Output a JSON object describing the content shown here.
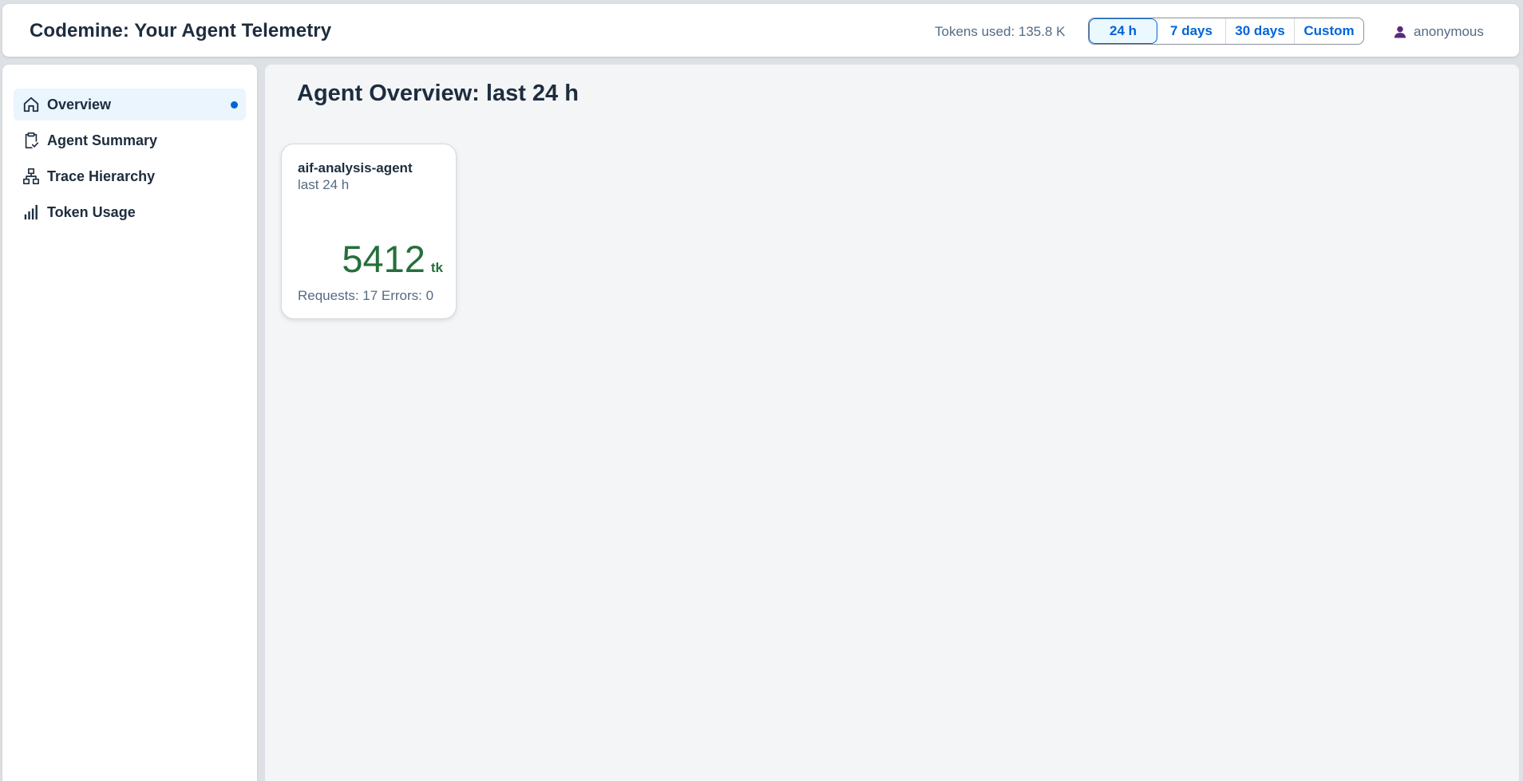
{
  "header": {
    "app_title": "Codemine: Your Agent Telemetry",
    "tokens_used": "Tokens used: 135.8 K",
    "time_ranges": [
      "24 h",
      "7 days",
      "30 days",
      "Custom"
    ],
    "selected_range": "24 h",
    "user_name": "anonymous",
    "user_icon": "person-icon"
  },
  "sidebar": {
    "items": [
      {
        "label": "Overview",
        "icon": "home-icon",
        "selected": true
      },
      {
        "label": "Agent Summary",
        "icon": "clipboard-check-icon",
        "selected": false
      },
      {
        "label": "Trace Hierarchy",
        "icon": "hierarchy-icon",
        "selected": false
      },
      {
        "label": "Token Usage",
        "icon": "bar-chart-icon",
        "selected": false
      }
    ]
  },
  "main": {
    "title": "Agent Overview: last 24 h",
    "cards": [
      {
        "title": "aif-analysis-agent",
        "subtitle": "last 24 h",
        "kpi_value": "5412",
        "kpi_unit": "tk",
        "footer": "Requests: 17 Errors: 0"
      }
    ]
  },
  "colors": {
    "accent": "#0064d9",
    "kpi_positive": "#256f3a",
    "text_primary": "#1d2d3e",
    "text_secondary": "#556b82",
    "selected_bg": "#eaf5fe"
  }
}
